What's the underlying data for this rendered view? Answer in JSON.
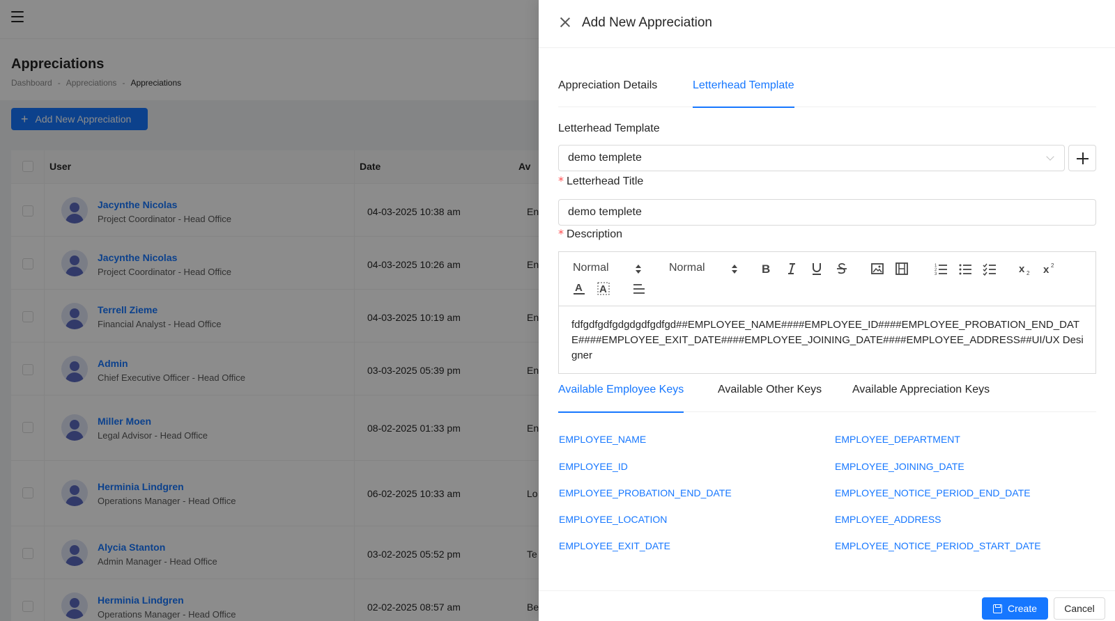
{
  "page": {
    "title": "Appreciations",
    "breadcrumb": [
      "Dashboard",
      "-",
      "Appreciations",
      "-",
      "Appreciations"
    ],
    "add_button": "Add New Appreciation",
    "table": {
      "headers": {
        "user": "User",
        "date": "Date",
        "third": "Av"
      },
      "rows": [
        {
          "name": "Jacynthe Nicolas",
          "role": "Project Coordinator - Head Office",
          "date": "04-03-2025 10:38 am",
          "trunc": "En"
        },
        {
          "name": "Jacynthe Nicolas",
          "role": "Project Coordinator - Head Office",
          "date": "04-03-2025 10:26 am",
          "trunc": "En"
        },
        {
          "name": "Terrell Zieme",
          "role": "Financial Analyst - Head Office",
          "date": "04-03-2025 10:19 am",
          "trunc": "En"
        },
        {
          "name": "Admin",
          "role": "Chief Executive Officer - Head Office",
          "date": "03-03-2025 05:39 pm",
          "trunc": "En"
        },
        {
          "name": "Miller Moen",
          "role": "Legal Advisor - Head Office",
          "date": "08-02-2025 01:33 pm",
          "trunc": "En"
        },
        {
          "name": "Herminia Lindgren",
          "role": "Operations Manager - Head Office",
          "date": "06-02-2025 10:33 am",
          "trunc": "Lo"
        },
        {
          "name": "Alycia Stanton",
          "role": "Admin Manager - Head Office",
          "date": "03-02-2025 05:52 pm",
          "trunc": "Te"
        },
        {
          "name": "Herminia Lindgren",
          "role": "Operations Manager - Head Office",
          "date": "02-02-2025 08:57 am",
          "trunc": "Be"
        }
      ]
    }
  },
  "drawer": {
    "title": "Add New Appreciation",
    "tabs": [
      "Appreciation Details",
      "Letterhead Template"
    ],
    "active_tab": "Letterhead Template",
    "letterhead_template_label": "Letterhead Template",
    "letterhead_template_value": "demo templete",
    "letterhead_title_label": "Letterhead Title",
    "letterhead_title_value": "demo templete",
    "description_label": "Description",
    "toolbar": {
      "font_size": "Normal",
      "heading": "Normal"
    },
    "description_text": "fdfgdfgdfgdgdgdfgdfgd##EMPLOYEE_NAME####EMPLOYEE_ID####EMPLOYEE_PROBATION_END_DATE####EMPLOYEE_EXIT_DATE####EMPLOYEE_JOINING_DATE####EMPLOYEE_ADDRESS##UI/UX Designer",
    "key_tabs": [
      "Available Employee Keys",
      "Available Other Keys",
      "Available Appreciation Keys"
    ],
    "employee_keys_left": [
      "EMPLOYEE_NAME",
      "EMPLOYEE_ID",
      "EMPLOYEE_PROBATION_END_DATE",
      "EMPLOYEE_LOCATION",
      "EMPLOYEE_EXIT_DATE"
    ],
    "employee_keys_right": [
      "EMPLOYEE_DEPARTMENT",
      "EMPLOYEE_JOINING_DATE",
      "EMPLOYEE_NOTICE_PERIOD_END_DATE",
      "EMPLOYEE_ADDRESS",
      "EMPLOYEE_NOTICE_PERIOD_START_DATE"
    ],
    "create_label": "Create",
    "cancel_label": "Cancel"
  },
  "colors": {
    "primary": "#1677ff",
    "required": "#ff4d4f",
    "overlay": "rgba(0,0,0,0.45)"
  }
}
